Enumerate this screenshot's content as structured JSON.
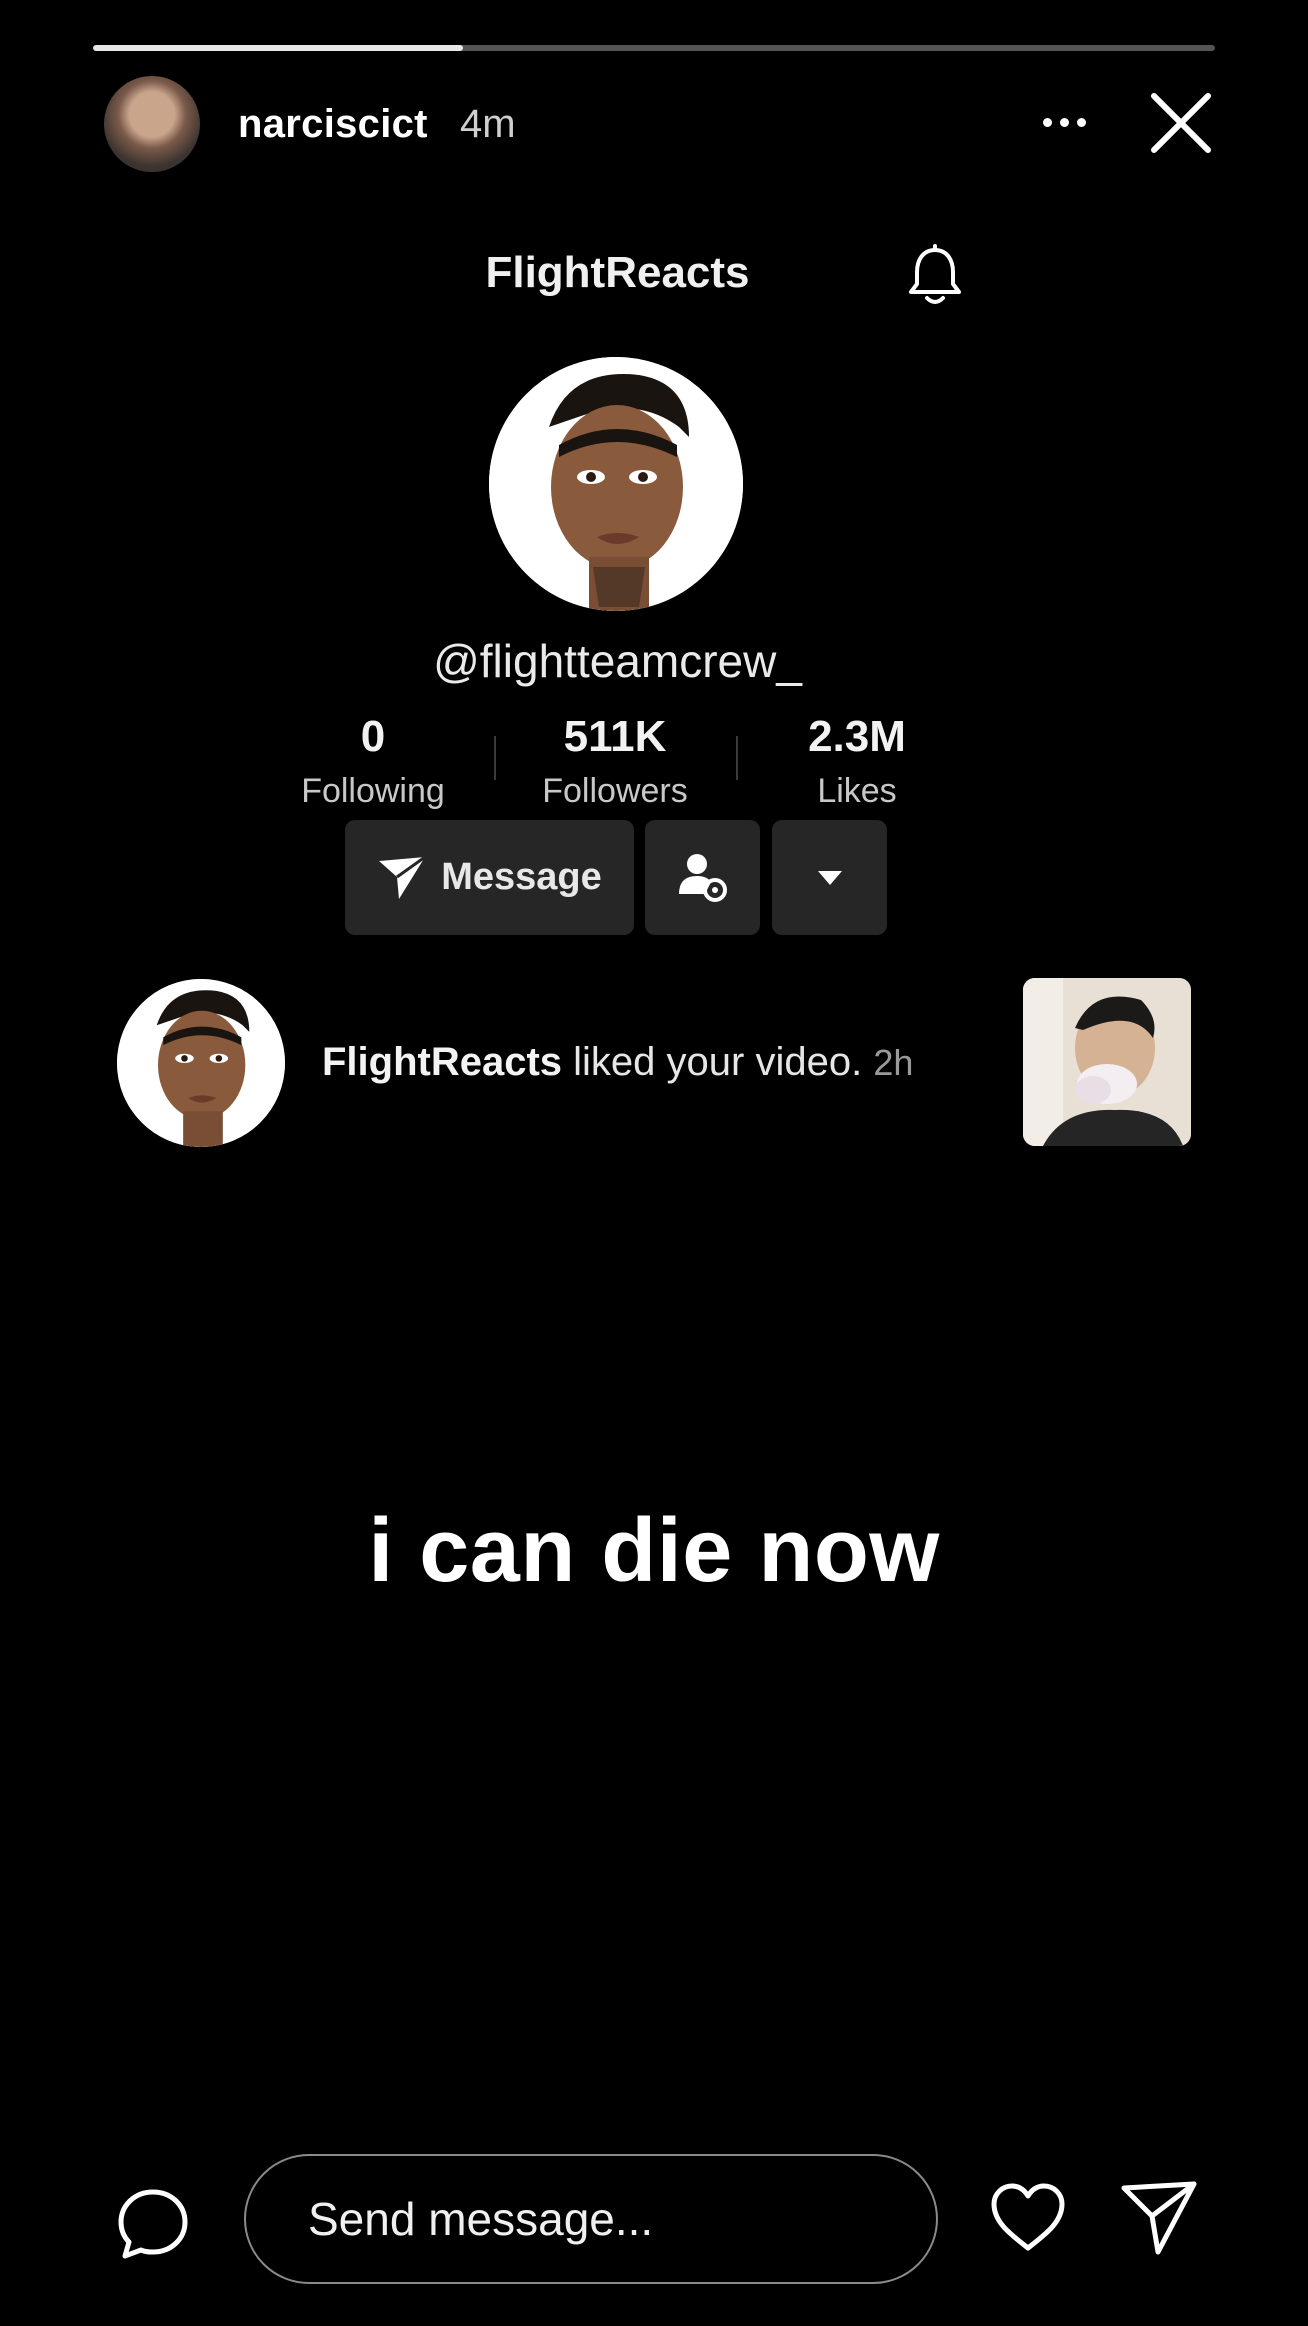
{
  "story": {
    "progress_fraction": 0.33,
    "username": "narciscict",
    "time": "4m",
    "more_icon": "more-horizontal-icon",
    "close_icon": "close-icon"
  },
  "profile": {
    "title": "FlightReacts",
    "handle": "@flightteamcrew_",
    "stats": [
      {
        "value": "0",
        "label": "Following"
      },
      {
        "value": "511K",
        "label": "Followers"
      },
      {
        "value": "2.3M",
        "label": "Likes"
      }
    ],
    "message_button": "Message",
    "bell_icon": "bell-icon"
  },
  "notification": {
    "name": "FlightReacts",
    "text": " liked your video. ",
    "time": "2h"
  },
  "caption": "i can die now",
  "bottom_bar": {
    "input_placeholder": "Send message...",
    "icons": [
      "chat-bubble-icon",
      "heart-icon",
      "send-icon"
    ]
  },
  "colors": {
    "background": "#000000",
    "button_bg": "#262626",
    "muted_text": "#cfcfcf"
  }
}
